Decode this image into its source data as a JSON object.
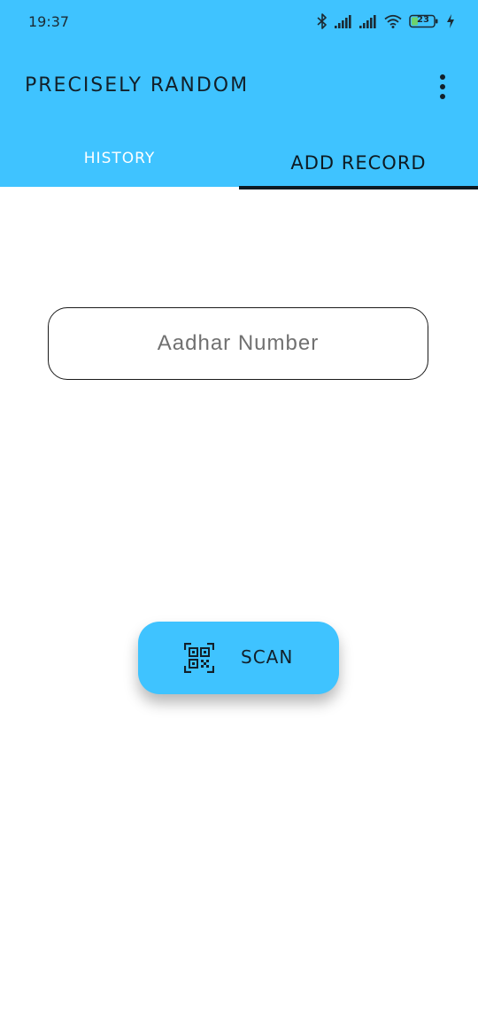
{
  "status_bar": {
    "time": "19:37",
    "battery_level": "23",
    "icons": [
      "bluetooth-icon",
      "signal-icon",
      "signal-icon",
      "wifi-icon",
      "battery-icon",
      "charging-icon"
    ]
  },
  "app": {
    "title": "Precisely Random",
    "menu_icon": "more-vertical-icon"
  },
  "tabs": [
    {
      "label": "History",
      "selected": false
    },
    {
      "label": "Add Record",
      "selected": true
    }
  ],
  "form": {
    "aadhar_placeholder": "Aadhar Number",
    "aadhar_value": ""
  },
  "scan_button": {
    "label": "Scan",
    "icon": "qr-code-scan-icon"
  },
  "colors": {
    "primary": "#3fc3ff",
    "text_dark": "#12202a",
    "tab_inactive_text": "#ffffff",
    "indicator": "#0d1a22"
  }
}
